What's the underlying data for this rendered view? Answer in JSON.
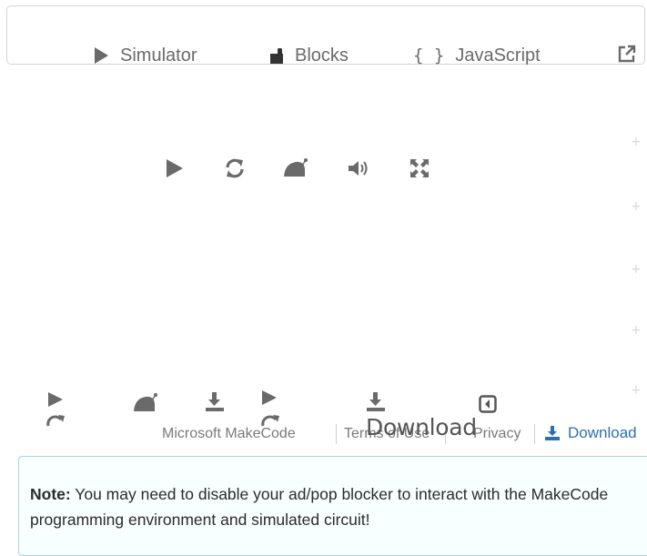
{
  "tabs": {
    "simulator": "Simulator",
    "blocks": "Blocks",
    "javascript": "JavaScript",
    "braces": "{ }"
  },
  "sim_controls": {
    "icons": [
      "play-icon",
      "restart-icon",
      "slow-mo-icon",
      "mute-icon",
      "fullscreen-icon"
    ]
  },
  "side_markers": [
    "+",
    "+",
    "+",
    "+",
    "+"
  ],
  "footer": {
    "brand": "Microsoft MakeCode",
    "terms": "Terms of Use",
    "privacy": "Privacy",
    "download_overlay": "Download",
    "download_link": "Download"
  },
  "note": {
    "label": "Note:",
    "text": " You may need to disable your ad/pop blocker to interact with the MakeCode programming environment and simulated circuit!"
  },
  "colors": {
    "icon_gray": "#6a6a6a",
    "link_blue": "#2d6fb1",
    "note_border": "#a9d5de",
    "note_bg": "#f8ffff"
  }
}
